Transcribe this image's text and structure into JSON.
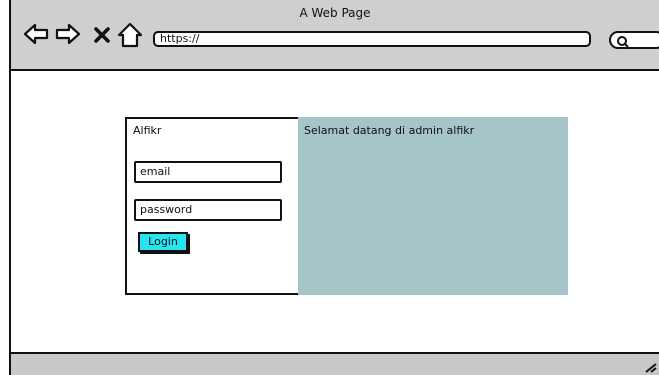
{
  "window": {
    "title": "A Web Page"
  },
  "toolbar": {
    "url": "https://"
  },
  "login": {
    "app_name": "Alfikr",
    "email_placeholder": "email",
    "password_placeholder": "password",
    "login_label": "Login"
  },
  "welcome": {
    "message": "Selamat datang di admin alfikr"
  },
  "colors": {
    "chrome": "#cfcfcf",
    "welcome_panel": "#a6c5c9",
    "login_button": "#26e5f0"
  },
  "icons": [
    "back-arrow-icon",
    "forward-arrow-icon",
    "close-icon",
    "home-icon",
    "search-icon",
    "resize-handle-icon"
  ]
}
